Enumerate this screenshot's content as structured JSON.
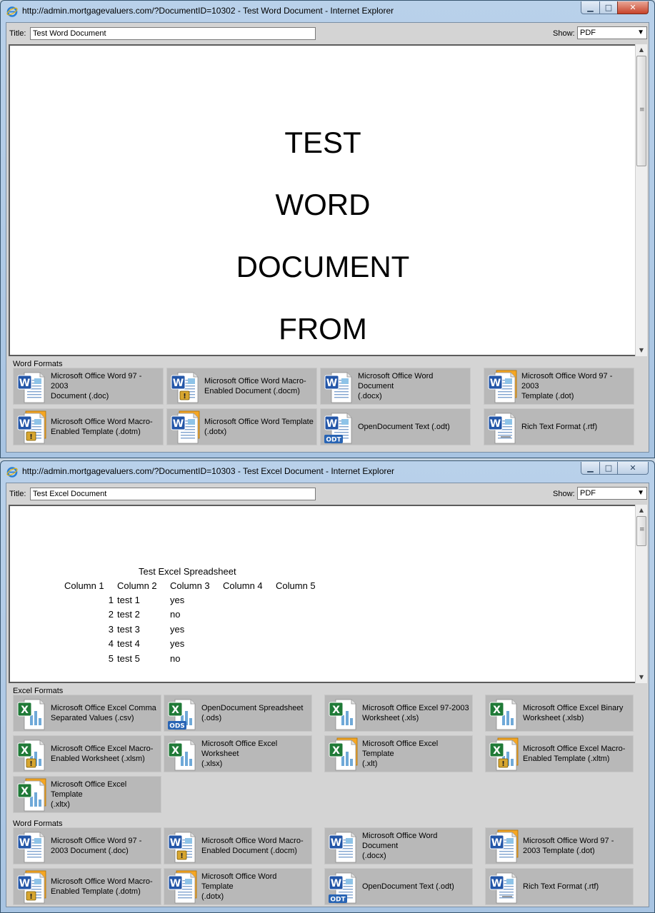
{
  "window1": {
    "title": "http://admin.mortgagevaluers.com/?DocumentID=10302 - Test Word Document - Internet Explorer",
    "title_label": "Title:",
    "title_value": "Test Word Document",
    "show_label": "Show:",
    "show_value": "PDF",
    "document_lines": [
      "TEST",
      "WORD",
      "DOCUMENT",
      "FROM"
    ],
    "section_label": "Word Formats",
    "formats": [
      {
        "icon": "word-doc-icon",
        "line1": "Microsoft Office Word 97 - 2003",
        "line2": "Document (.doc)"
      },
      {
        "icon": "word-docm-icon",
        "line1": "Microsoft Office Word Macro-",
        "line2": "Enabled Document (.docm)"
      },
      {
        "icon": "word-docx-icon",
        "line1": "Microsoft Office Word Document",
        "line2": "(.docx)"
      },
      {
        "icon": "word-dot-icon",
        "line1": "Microsoft Office Word 97 - 2003",
        "line2": "Template (.dot)"
      },
      {
        "icon": "word-dotm-icon",
        "line1": "Microsoft Office Word Macro-",
        "line2": "Enabled Template (.dotm)"
      },
      {
        "icon": "word-dotx-icon",
        "line1": "Microsoft Office Word Template",
        "line2": "(.dotx)"
      },
      {
        "icon": "odt-icon",
        "line1": "OpenDocument Text (.odt)",
        "line2": ""
      },
      {
        "icon": "rtf-icon",
        "line1": "Rich Text Format (.rtf)",
        "line2": ""
      }
    ]
  },
  "window2": {
    "title": "http://admin.mortgagevaluers.com/?DocumentID=10303 - Test Excel Document - Internet Explorer",
    "title_label": "Title:",
    "title_value": "Test Excel Document",
    "show_label": "Show:",
    "show_value": "PDF",
    "spreadsheet": {
      "heading": "Test Excel Spreadsheet",
      "columns": [
        "Column 1",
        "Column 2",
        "Column 3",
        "Column 4",
        "Column 5"
      ],
      "rows": [
        {
          "num": "1",
          "name": "test 1",
          "flag": "yes"
        },
        {
          "num": "2",
          "name": "test 2",
          "flag": "no"
        },
        {
          "num": "3",
          "name": "test 3",
          "flag": "yes"
        },
        {
          "num": "4",
          "name": "test 4",
          "flag": "yes"
        },
        {
          "num": "5",
          "name": "test 5",
          "flag": "no"
        }
      ]
    },
    "excel_section_label": "Excel Formats",
    "excel_formats": [
      {
        "icon": "excel-csv-icon",
        "line1": "Microsoft Office Excel Comma",
        "line2": "Separated Values (.csv)"
      },
      {
        "icon": "ods-icon",
        "line1": "OpenDocument Spreadsheet",
        "line2": "(.ods)"
      },
      {
        "icon": "excel-xls-icon",
        "line1": "Microsoft Office Excel 97-2003",
        "line2": "Worksheet (.xls)"
      },
      {
        "icon": "excel-xlsb-icon",
        "line1": "Microsoft Office Excel Binary",
        "line2": "Worksheet (.xlsb)"
      },
      {
        "icon": "excel-xlsm-icon",
        "line1": "Microsoft Office Excel Macro-",
        "line2": "Enabled Worksheet (.xlsm)"
      },
      {
        "icon": "excel-xlsx-icon",
        "line1": "Microsoft Office Excel Worksheet",
        "line2": "(.xlsx)"
      },
      {
        "icon": "excel-xlt-icon",
        "line1": "Microsoft Office Excel Template",
        "line2": "(.xlt)"
      },
      {
        "icon": "excel-xltm-icon",
        "line1": "Microsoft Office Excel Macro-",
        "line2": "Enabled Template (.xltm)"
      },
      {
        "icon": "excel-xltx-icon",
        "line1": "Microsoft Office Excel Template",
        "line2": "(.xltx)"
      }
    ],
    "word_section_label": "Word Formats",
    "word_formats": [
      {
        "icon": "word-doc-icon",
        "line1": "Microsoft Office Word 97 -",
        "line2": "2003 Document (.doc)"
      },
      {
        "icon": "word-docm-icon",
        "line1": "Microsoft Office Word Macro-",
        "line2": "Enabled Document (.docm)"
      },
      {
        "icon": "word-docx-icon",
        "line1": "Microsoft Office Word Document",
        "line2": "(.docx)"
      },
      {
        "icon": "word-dot-icon",
        "line1": "Microsoft Office Word 97 -",
        "line2": "2003 Template (.dot)"
      },
      {
        "icon": "word-dotm-icon",
        "line1": "Microsoft Office Word Macro-",
        "line2": "Enabled Template (.dotm)"
      },
      {
        "icon": "word-dotx-icon",
        "line1": "Microsoft Office Word Template",
        "line2": "(.dotx)"
      },
      {
        "icon": "odt-icon",
        "line1": "OpenDocument Text (.odt)",
        "line2": ""
      },
      {
        "icon": "rtf-icon",
        "line1": "Rich Text Format (.rtf)",
        "line2": ""
      }
    ]
  }
}
